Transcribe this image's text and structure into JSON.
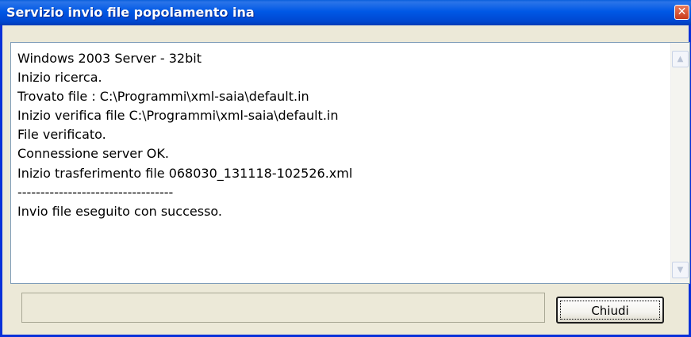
{
  "window": {
    "title": "Servizio invio file popolamento ina",
    "close_glyph": "✕"
  },
  "log": {
    "lines": [
      "Windows 2003 Server - 32bit",
      "Inizio ricerca.",
      "Trovato file : C:\\Programmi\\xml-saia\\default.in",
      "Inizio verifica file C:\\Programmi\\xml-saia\\default.in",
      "File verificato.",
      "Connessione server OK.",
      "Inizio trasferimento file 068030_131118-102526.xml",
      "----------------------------------",
      "Invio file eseguito con successo."
    ]
  },
  "scrollbar": {
    "up_icon": "chevron-up-icon",
    "down_icon": "chevron-down-icon"
  },
  "footer": {
    "status_text": "",
    "close_button_label": "Chiudi"
  }
}
